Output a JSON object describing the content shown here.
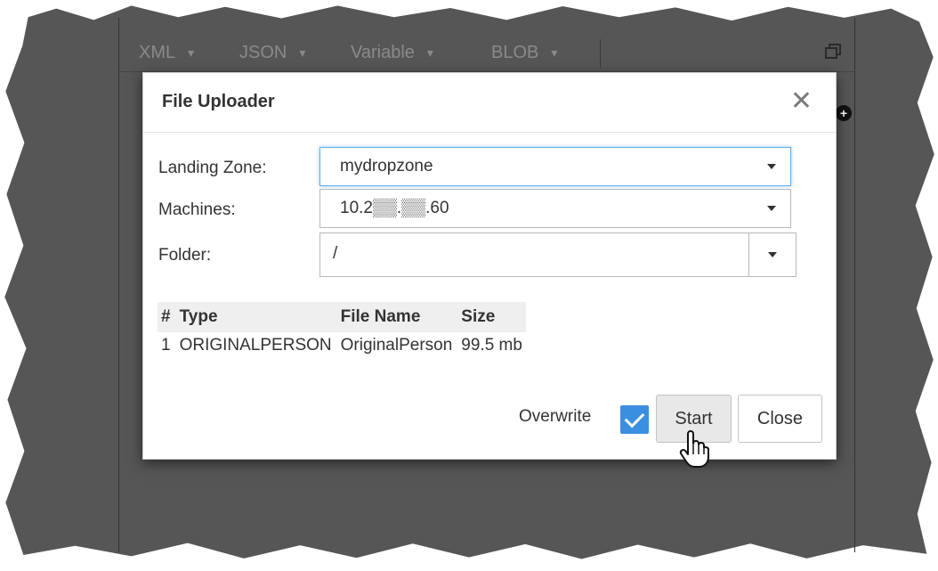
{
  "toolbar": {
    "menus": [
      "XML",
      "JSON",
      "Variable",
      "BLOB"
    ],
    "caret": "▾",
    "restore_icon": "restore-window-icon"
  },
  "dialog": {
    "title": "File Uploader",
    "close_glyph": "✕",
    "landing_zone": {
      "label": "Landing Zone:",
      "value": "mydropzone"
    },
    "machines": {
      "label": "Machines:",
      "value": "10.2▒▒.▒▒.60"
    },
    "folder": {
      "label": "Folder:",
      "value": "/"
    },
    "table": {
      "columns": [
        "#",
        "Type",
        "File Name",
        "Size"
      ],
      "rows": [
        {
          "num": "1",
          "type": "ORIGINALPERSON",
          "file_name": "OriginalPerson",
          "size": "99.5 mb"
        }
      ]
    },
    "overwrite": {
      "label": "Overwrite",
      "checked": true
    },
    "buttons": {
      "start": "Start",
      "close": "Close"
    }
  },
  "colors": {
    "backdrop": "#565656",
    "accent": "#3b8fe0",
    "focus_border": "#66afe9"
  }
}
